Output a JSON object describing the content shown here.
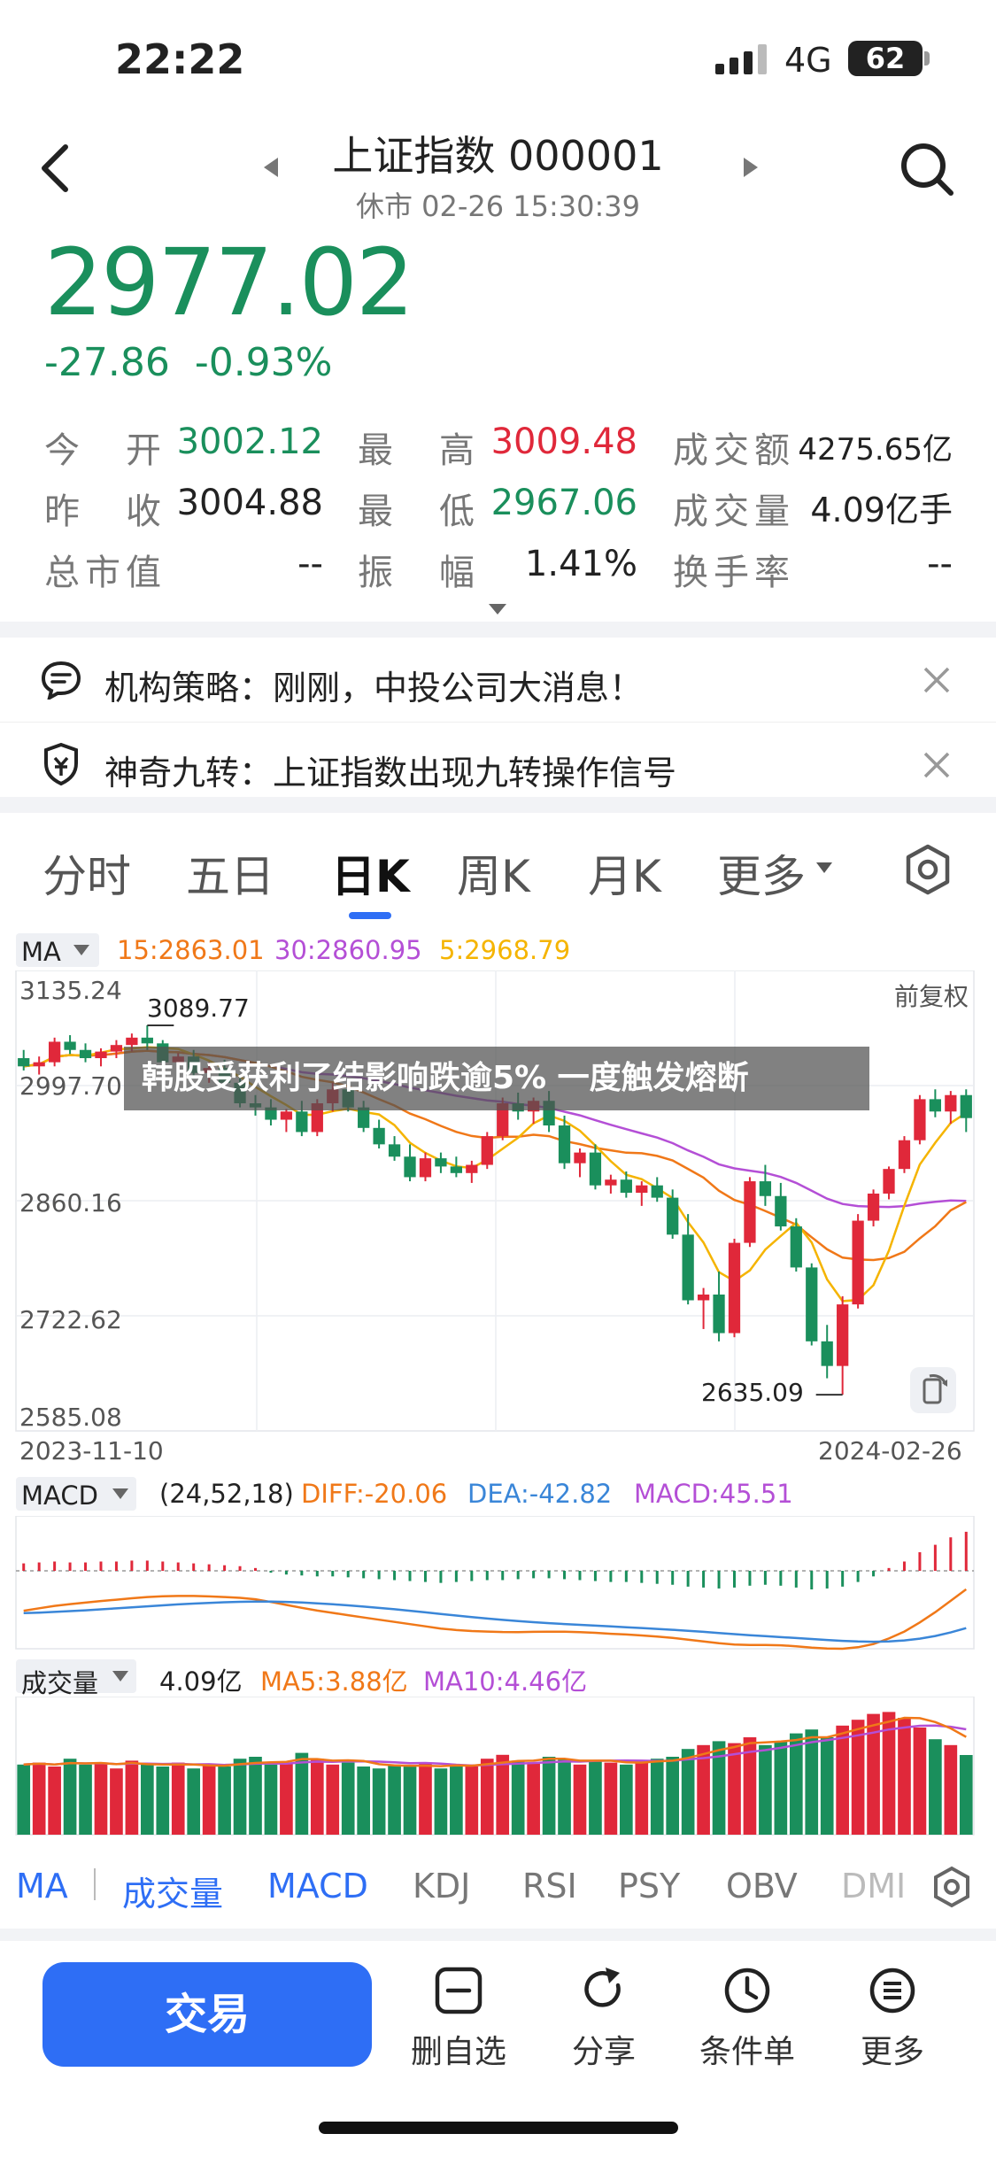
{
  "status": {
    "time": "22:22",
    "network": "4G",
    "battery": "62"
  },
  "header": {
    "title": "上证指数 000001",
    "subtitle": "休市 02-26 15:30:39"
  },
  "quote": {
    "price": "2977.02",
    "change": "-27.86",
    "change_pct": "-0.93%",
    "open_label": "今　开",
    "open": "3002.12",
    "high_label": "最　高",
    "high": "3009.48",
    "amount_label": "成交额",
    "amount": "4275.65亿",
    "prevclose_label": "昨　收",
    "prevclose": "3004.88",
    "low_label": "最　低",
    "low": "2967.06",
    "volume_label": "成交量",
    "volume": "4.09亿手",
    "mktcap_label": "总市值",
    "mktcap": "--",
    "amplitude_label": "振　幅",
    "amplitude": "1.41%",
    "turnover_label": "换手率",
    "turnover": "--"
  },
  "notices": [
    {
      "text": "机构策略：刚刚，中投公司大消息！"
    },
    {
      "text": "神奇九转：上证指数出现九转操作信号"
    }
  ],
  "tabs": [
    "分时",
    "五日",
    "日K",
    "周K",
    "月K",
    "更多"
  ],
  "overlay": {
    "headline": "韩股受获利了结影响跌逾5% 一度触发熔断"
  },
  "ma_legend": {
    "label": "MA",
    "ma15": "15:2863.01",
    "ma30": "30:2860.95",
    "ma5": "5:2968.79",
    "adjust": "前复权"
  },
  "macd_legend": {
    "label": "MACD",
    "params": "(24,52,18)",
    "diff": "DIFF:-20.06",
    "dea": "DEA:-42.82",
    "macd": "MACD:45.51"
  },
  "vol_legend": {
    "label": "成交量",
    "value": "4.09亿",
    "ma5": "MA5:3.88亿",
    "ma10": "MA10:4.46亿"
  },
  "indicator_tabs": [
    "MA",
    "成交量",
    "MACD",
    "KDJ",
    "RSI",
    "PSY",
    "OBV",
    "DMI"
  ],
  "bottom": {
    "trade": "交易",
    "remove_watch": "删自选",
    "share": "分享",
    "condition_order": "条件单",
    "more": "更多"
  },
  "colors": {
    "up": "#e0283a",
    "down": "#1a8f5c",
    "ma5": "#f5b400",
    "ma15": "#f07818",
    "ma30": "#b44fd6",
    "accent": "#2e6ef5"
  },
  "chart_data": {
    "type": "candlestick",
    "ylim": [
      2585.08,
      3135.24
    ],
    "yticks": [
      "3135.24",
      "2997.70",
      "2860.16",
      "2722.62",
      "2585.08"
    ],
    "xstart": "2023-11-10",
    "xend": "2024-02-26",
    "max_label": "3089.77",
    "min_label": "2635.09",
    "candles": [
      [
        3050,
        3060,
        3035,
        3040
      ],
      [
        3040,
        3052,
        3030,
        3045
      ],
      [
        3045,
        3075,
        3040,
        3070
      ],
      [
        3070,
        3078,
        3055,
        3060
      ],
      [
        3060,
        3068,
        3045,
        3050
      ],
      [
        3050,
        3062,
        3040,
        3058
      ],
      [
        3058,
        3072,
        3050,
        3066
      ],
      [
        3066,
        3080,
        3058,
        3075
      ],
      [
        3075,
        3090,
        3060,
        3068
      ],
      [
        3068,
        3072,
        3040,
        3045
      ],
      [
        3045,
        3056,
        3030,
        3052
      ],
      [
        3052,
        3060,
        3028,
        3032
      ],
      [
        3032,
        3045,
        3020,
        3038
      ],
      [
        3038,
        3048,
        3015,
        3020
      ],
      [
        3020,
        3030,
        2990,
        2995
      ],
      [
        2995,
        3005,
        2980,
        2990
      ],
      [
        2990,
        3000,
        2968,
        2975
      ],
      [
        2975,
        2988,
        2960,
        2985
      ],
      [
        2985,
        2998,
        2955,
        2960
      ],
      [
        2960,
        3000,
        2955,
        2995
      ],
      [
        2995,
        3020,
        2985,
        3012
      ],
      [
        3012,
        3018,
        2985,
        2990
      ],
      [
        2990,
        2998,
        2960,
        2965
      ],
      [
        2965,
        2975,
        2940,
        2945
      ],
      [
        2945,
        2955,
        2925,
        2930
      ],
      [
        2930,
        2945,
        2900,
        2905
      ],
      [
        2905,
        2935,
        2900,
        2928
      ],
      [
        2928,
        2935,
        2910,
        2918
      ],
      [
        2918,
        2930,
        2905,
        2910
      ],
      [
        2910,
        2925,
        2898,
        2920
      ],
      [
        2920,
        2960,
        2915,
        2955
      ],
      [
        2955,
        3002,
        2950,
        2995
      ],
      [
        2995,
        3008,
        2975,
        2985
      ],
      [
        2985,
        3002,
        2970,
        2998
      ],
      [
        2998,
        3010,
        2960,
        2968
      ],
      [
        2968,
        2980,
        2915,
        2922
      ],
      [
        2922,
        2940,
        2905,
        2935
      ],
      [
        2935,
        2945,
        2890,
        2895
      ],
      [
        2895,
        2908,
        2885,
        2902
      ],
      [
        2902,
        2912,
        2880,
        2886
      ],
      [
        2886,
        2900,
        2870,
        2895
      ],
      [
        2895,
        2905,
        2875,
        2880
      ],
      [
        2880,
        2890,
        2830,
        2835
      ],
      [
        2835,
        2860,
        2750,
        2755
      ],
      [
        2755,
        2770,
        2720,
        2762
      ],
      [
        2762,
        2790,
        2705,
        2715
      ],
      [
        2715,
        2830,
        2710,
        2825
      ],
      [
        2825,
        2905,
        2820,
        2900
      ],
      [
        2900,
        2920,
        2870,
        2882
      ],
      [
        2882,
        2898,
        2840,
        2845
      ],
      [
        2845,
        2855,
        2790,
        2795
      ],
      [
        2795,
        2800,
        2700,
        2705
      ],
      [
        2705,
        2725,
        2660,
        2675
      ],
      [
        2675,
        2760,
        2640,
        2750
      ],
      [
        2750,
        2860,
        2745,
        2852
      ],
      [
        2852,
        2890,
        2845,
        2885
      ],
      [
        2885,
        2918,
        2878,
        2915
      ],
      [
        2915,
        2955,
        2910,
        2950
      ],
      [
        2950,
        3005,
        2945,
        3000
      ],
      [
        3000,
        3012,
        2978,
        2985
      ],
      [
        2985,
        3010,
        2970,
        3005
      ],
      [
        3005,
        3012,
        2960,
        2977
      ]
    ],
    "macd_hist": [
      8,
      9,
      10,
      9,
      9,
      10,
      10,
      11,
      11,
      10,
      9,
      8,
      7,
      6,
      5,
      3,
      -2,
      -4,
      -5,
      -6,
      -6,
      -7,
      -8,
      -9,
      -10,
      -11,
      -12,
      -13,
      -12,
      -11,
      -10,
      -10,
      -9,
      -8,
      -8,
      -9,
      -10,
      -11,
      -12,
      -12,
      -13,
      -14,
      -15,
      -17,
      -18,
      -19,
      -18,
      -16,
      -15,
      -16,
      -18,
      -20,
      -19,
      -17,
      -12,
      -6,
      3,
      10,
      20,
      28,
      36,
      42
    ],
    "vol_bars": [
      3.6,
      3.7,
      3.5,
      3.9,
      3.6,
      3.7,
      3.4,
      3.8,
      3.6,
      3.5,
      3.7,
      3.4,
      3.6,
      3.5,
      3.9,
      4.0,
      3.6,
      3.7,
      4.2,
      3.9,
      3.6,
      3.7,
      3.5,
      3.4,
      3.6,
      3.5,
      3.7,
      3.4,
      3.6,
      3.5,
      3.9,
      4.1,
      3.8,
      3.7,
      4.0,
      3.9,
      3.6,
      3.8,
      3.7,
      3.6,
      3.8,
      3.9,
      4.0,
      4.4,
      4.6,
      4.8,
      4.7,
      5.0,
      4.6,
      4.8,
      5.2,
      5.4,
      5.0,
      5.6,
      5.9,
      6.2,
      6.3,
      6.0,
      5.5,
      4.9,
      4.6,
      4.09
    ]
  }
}
